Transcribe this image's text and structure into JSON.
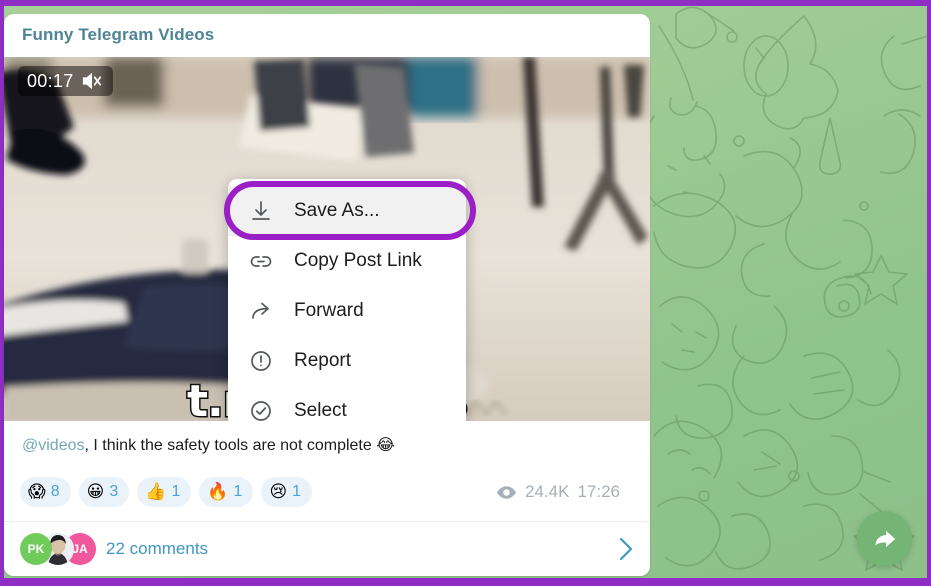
{
  "annotation": {
    "frame_color": "#8e2ec4",
    "highlight_color": "#9a1fc6",
    "highlight_target": "Save As..."
  },
  "wallpaper": {
    "name": "telegram-green-doodle-pattern",
    "color_top": "#a8cf9a",
    "color_bottom": "#8ec08a"
  },
  "card": {
    "channel_title": "Funny Telegram Videos",
    "title_color": "#4e8596"
  },
  "video": {
    "duration": "00:17",
    "mute_icon": "speaker-muted-icon",
    "watermark": "t.me/videos"
  },
  "context_menu": {
    "items": [
      {
        "label": "Save As...",
        "icon": "download-icon",
        "selected": true
      },
      {
        "label": "Copy Post Link",
        "icon": "link-icon",
        "selected": false
      },
      {
        "label": "Forward",
        "icon": "forward-arrow-icon",
        "selected": false
      },
      {
        "label": "Report",
        "icon": "exclamation-circle-icon",
        "selected": false
      },
      {
        "label": "Select",
        "icon": "check-circle-icon",
        "selected": false
      }
    ]
  },
  "caption": {
    "mention": "@videos",
    "text": ", I think the safety tools are not complete ",
    "emoji": "😂"
  },
  "reactions": [
    {
      "emoji": "😱",
      "count": "8"
    },
    {
      "emoji": "😀",
      "count": "3"
    },
    {
      "emoji": "👍",
      "count": "1"
    },
    {
      "emoji": "🔥",
      "count": "1"
    },
    {
      "emoji": "😢",
      "count": "1"
    }
  ],
  "meta": {
    "views_icon": "eye-icon",
    "views": "24.4K",
    "time": "17:26"
  },
  "comments": {
    "label": "22 comments",
    "avatars": [
      {
        "initials": "PK",
        "color": "#6fcc5b"
      },
      {
        "initials": "",
        "color": "#cfd4d8"
      },
      {
        "initials": "JA",
        "color": "#f0579c"
      }
    ],
    "chevron_icon": "chevron-right-icon"
  },
  "fab": {
    "icon": "share-forward-icon",
    "color": "#74b475"
  }
}
